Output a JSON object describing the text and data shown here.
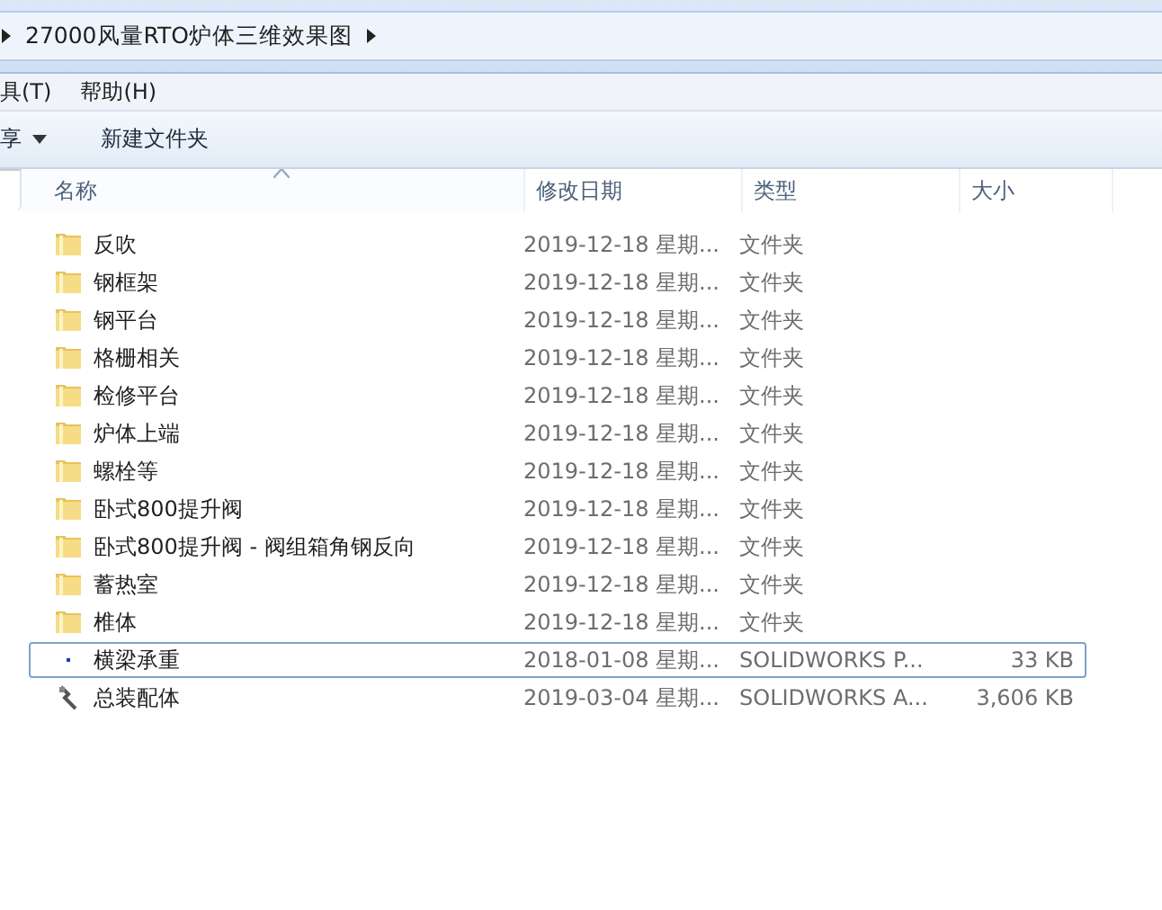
{
  "address_bar": {
    "path": "27000风量RTO炉体三维效果图"
  },
  "menu_bar": [
    "具(T)",
    "帮助(H)"
  ],
  "toolbar": {
    "share": "享",
    "new_folder": "新建文件夹"
  },
  "table": {
    "columns": [
      {
        "label": "名称",
        "sorted": true
      },
      {
        "label": "修改日期",
        "sorted": false
      },
      {
        "label": "类型",
        "sorted": false
      },
      {
        "label": "大小",
        "sorted": false
      }
    ],
    "rows": [
      {
        "kind": "folder",
        "name": "反吹",
        "date": "2019-12-18 星期...",
        "type": "文件夹",
        "focused": false
      },
      {
        "kind": "folder",
        "name": "钢框架",
        "date": "2019-12-18 星期...",
        "type": "文件夹",
        "focused": false
      },
      {
        "kind": "folder",
        "name": "钢平台",
        "date": "2019-12-18 星期...",
        "type": "文件夹",
        "focused": false
      },
      {
        "kind": "folder",
        "name": "格栅相关",
        "date": "2019-12-18 星期...",
        "type": "文件夹",
        "focused": false
      },
      {
        "kind": "folder",
        "name": "检修平台",
        "date": "2019-12-18 星期...",
        "type": "文件夹",
        "focused": false
      },
      {
        "kind": "folder",
        "name": "炉体上端",
        "date": "2019-12-18 星期...",
        "type": "文件夹",
        "focused": false
      },
      {
        "kind": "folder",
        "name": "螺栓等",
        "date": "2019-12-18 星期...",
        "type": "文件夹",
        "focused": false
      },
      {
        "kind": "folder",
        "name": "卧式800提升阀",
        "date": "2019-12-18 星期...",
        "type": "文件夹",
        "focused": false
      },
      {
        "kind": "folder",
        "name": "卧式800提升阀 - 阀组箱角钢反向",
        "date": "2019-12-18 星期...",
        "type": "文件夹",
        "focused": false
      },
      {
        "kind": "folder",
        "name": "蓄热室",
        "date": "2019-12-18 星期...",
        "type": "文件夹",
        "focused": false
      },
      {
        "kind": "folder",
        "name": "椎体",
        "date": "2019-12-18 星期...",
        "type": "文件夹",
        "focused": false
      },
      {
        "kind": "part",
        "name": "横梁承重",
        "date": "2018-01-08 星期...",
        "type": "SOLIDWORKS P...",
        "size": "33 KB",
        "focused": true
      },
      {
        "kind": "assembly",
        "name": "总装配体",
        "date": "2019-03-04 星期...",
        "type": "SOLIDWORKS A...",
        "size": "3,606 KB",
        "focused": false
      }
    ]
  }
}
